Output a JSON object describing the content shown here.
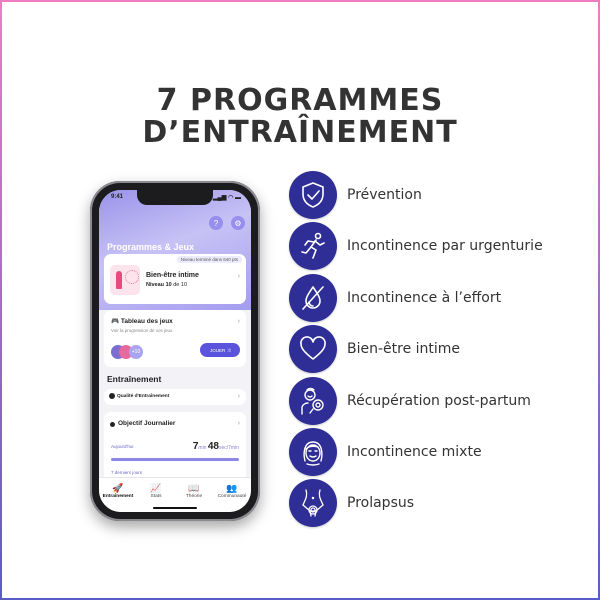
{
  "headline": {
    "line1": "7 PROGRAMMES",
    "line2": "D’ENTRAÎNEMENT"
  },
  "colors": {
    "icon_circle": "#2e2e96",
    "accent": "#5a54dc",
    "border_top": "#f07cc0",
    "border_bottom": "#5a5cc8"
  },
  "phone": {
    "status_time": "9:41",
    "status_icons": "signal wifi battery",
    "help_icon": "?",
    "settings_icon": "⚙",
    "section_title": "Programmes & Jeux",
    "level_card": {
      "badge": "Niveau terminé dans 640 pts",
      "title": "Bien-être intime",
      "level_prefix": "Niveau",
      "level_value": "10",
      "level_suffix": "de 10",
      "chevron": "›"
    },
    "games_card": {
      "title": "🎮 Tableau des jeux",
      "subtitle": "Voir la progression de vos jeux.",
      "more_count": "+10",
      "play_label": "JOUER ⤨",
      "chevron": "›"
    },
    "training_title": "Entraînement",
    "quality_card": {
      "title": "Qualité d'Entraînement",
      "chevron": "›"
    },
    "daily_card": {
      "title": "Objectif Journalier",
      "today_label": "Aujourd'hui",
      "minutes": "7",
      "min_unit": "min",
      "seconds": "48",
      "sec_unit": "sec/7min",
      "progress": 1.0,
      "last7_label": "7 derniers jours",
      "chevron": "›"
    },
    "tabs": [
      {
        "label": "Entraînement",
        "icon": "🚀",
        "active": true
      },
      {
        "label": "Stats",
        "icon": "📈",
        "active": false
      },
      {
        "label": "Théorie",
        "icon": "📖",
        "active": false
      },
      {
        "label": "Communauté",
        "icon": "👥",
        "active": false
      }
    ]
  },
  "programs": [
    {
      "label": "Prévention",
      "icon": "shield-check-icon"
    },
    {
      "label": "Incontinence par urgenturie",
      "icon": "running-person-icon"
    },
    {
      "label": "Incontinence à l’effort",
      "icon": "drop-slash-icon"
    },
    {
      "label": "Bien-être intime",
      "icon": "heart-icon"
    },
    {
      "label": "Récupération post-partum",
      "icon": "mother-baby-icon"
    },
    {
      "label": "Incontinence mixte",
      "icon": "woman-face-icon"
    },
    {
      "label": "Prolapsus",
      "icon": "pelvis-target-icon"
    }
  ]
}
